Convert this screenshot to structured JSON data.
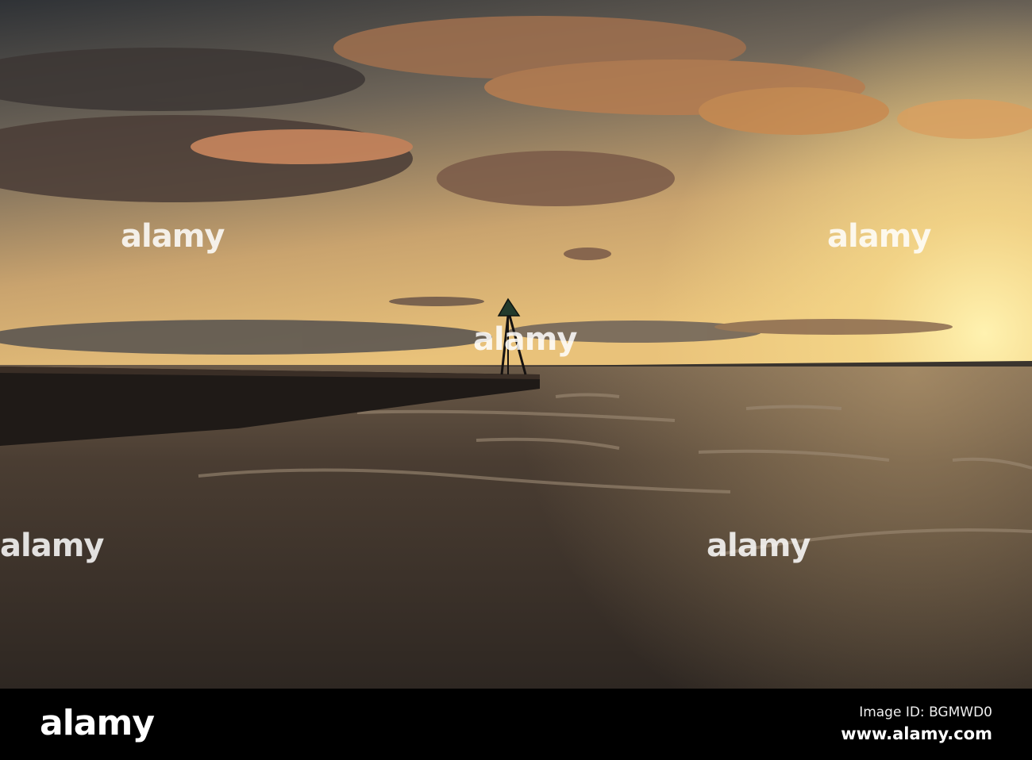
{
  "photo": {
    "subject": "Sunset over choppy sea with wooden groyne and triangular marker post",
    "colors": {
      "sky_top": "#3a3a40",
      "sky_glow": "#f6d98a",
      "sea": "#3e342c",
      "cloud": "#6a584c"
    }
  },
  "watermark": {
    "text": "alamy"
  },
  "footer": {
    "logo": "alamy",
    "image_id": "Image ID: BGMWD0",
    "url": "www.alamy.com"
  }
}
